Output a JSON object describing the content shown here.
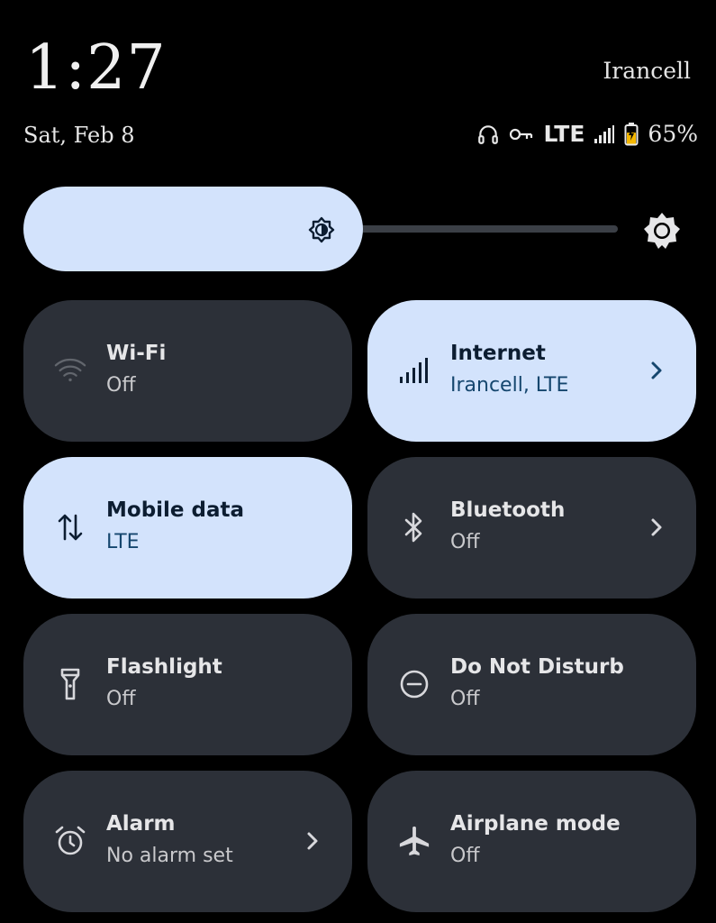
{
  "header": {
    "time": "1:27",
    "carrier": "Irancell",
    "date": "Sat, Feb 8"
  },
  "status_bar": {
    "icons": [
      "headphones-icon",
      "vpn-key-icon",
      "signal-icon",
      "battery-charging-icon"
    ],
    "network": "LTE",
    "battery_percent": "65%",
    "battery_level": 0.65
  },
  "brightness": {
    "level": 0.5,
    "accent_color": "#d3e3fc"
  },
  "tiles": [
    {
      "title": "Wi-Fi",
      "subtitle": "Off",
      "icon": "wifi-icon",
      "active": false,
      "chevron": false
    },
    {
      "title": "Internet",
      "subtitle": "Irancell, LTE",
      "icon": "signal-bars-icon",
      "active": true,
      "chevron": true
    },
    {
      "title": "Mobile data",
      "subtitle": "LTE",
      "icon": "mobile-data-icon",
      "active": true,
      "chevron": false
    },
    {
      "title": "Bluetooth",
      "subtitle": "Off",
      "icon": "bluetooth-icon",
      "active": false,
      "chevron": true
    },
    {
      "title": "Flashlight",
      "subtitle": "Off",
      "icon": "flashlight-icon",
      "active": false,
      "chevron": false
    },
    {
      "title": "Do Not Disturb",
      "subtitle": "Off",
      "icon": "do-not-disturb-icon",
      "active": false,
      "chevron": false
    },
    {
      "title": "Alarm",
      "subtitle": "No alarm set",
      "icon": "alarm-icon",
      "active": false,
      "chevron": true
    },
    {
      "title": "Airplane mode",
      "subtitle": "Off",
      "icon": "airplane-icon",
      "active": false,
      "chevron": false
    }
  ],
  "colors": {
    "background": "#000000",
    "tile_off": "#2c3038",
    "tile_on": "#d3e3fc",
    "text_on": "#0c1d31"
  }
}
